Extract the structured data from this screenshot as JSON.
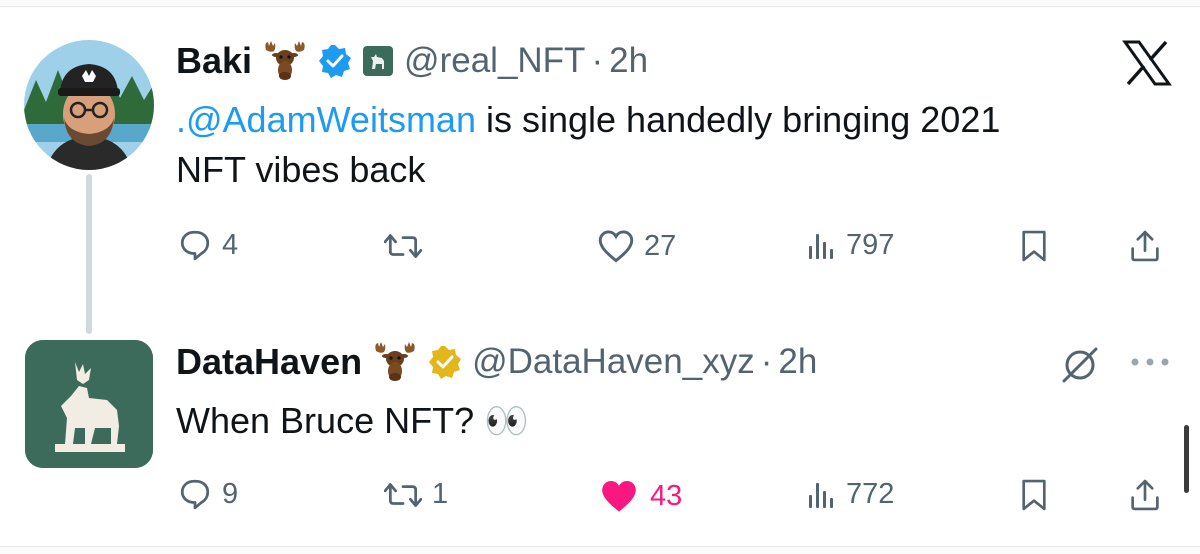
{
  "tweets": [
    {
      "display_name": "Baki",
      "handle": "@real_NFT",
      "separator": "·",
      "time": "2h",
      "verified": "blue",
      "mention": ".@AdamWeitsman",
      "text_rest": " is single handedly bringing 2021",
      "text_line2": "NFT vibes back",
      "replies": "4",
      "retweets": "",
      "likes": "27",
      "views": "797",
      "liked": false
    },
    {
      "display_name": "DataHaven",
      "handle": "@DataHaven_xyz",
      "separator": "·",
      "time": "2h",
      "verified": "gold",
      "text": "When Bruce NFT? 👀",
      "replies": "9",
      "retweets": "1",
      "likes": "43",
      "views": "772",
      "liked": true
    }
  ],
  "colors": {
    "link": "#1d9bf0",
    "secondary_text": "#536471",
    "like_active": "#f91880",
    "verified_blue": "#1d9bf0",
    "verified_gold": "#e2b719",
    "brand_green": "#3d6b5b"
  },
  "icons": [
    "x-logo-icon",
    "moose-emoji-icon",
    "verified-badge-icon",
    "reply-icon",
    "retweet-icon",
    "like-icon",
    "views-icon",
    "bookmark-icon",
    "share-icon",
    "grok-icon",
    "more-icon"
  ]
}
